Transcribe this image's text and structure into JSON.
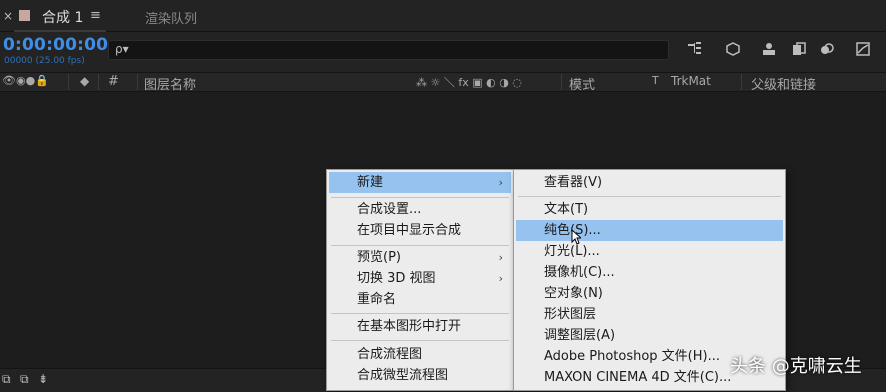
{
  "tabs": {
    "close": "×",
    "active_title": "合成 1",
    "menu": "≡",
    "inactive_title": "渲染队列"
  },
  "toolbar": {
    "timecode": "0:00:00:00",
    "frames": "00000 (25.00 fps)",
    "search_icon": "ρ▾"
  },
  "columns": {
    "layer_name": "图层名称",
    "hash": "#",
    "switches": "⁂ ☼ ＼ fx ▣ ◐ ◑ ◌",
    "mode": "模式",
    "t": "T",
    "trkmat": "TrkMat",
    "parent": "父级和链接"
  },
  "main_menu": {
    "items": [
      {
        "label": "新建",
        "submenu": true,
        "highlighted": true
      },
      {
        "label": "合成设置..."
      },
      {
        "label": "在项目中显示合成"
      },
      {
        "label": "预览(P)",
        "submenu": true
      },
      {
        "label": "切换 3D 视图",
        "submenu": true
      },
      {
        "label": "重命名"
      },
      {
        "label": "在基本图形中打开"
      },
      {
        "label": "合成流程图"
      },
      {
        "label": "合成微型流程图"
      }
    ]
  },
  "sub_menu": {
    "items": [
      {
        "label": "查看器(V)"
      },
      {
        "label": "文本(T)"
      },
      {
        "label": "纯色(S)...",
        "highlighted": true
      },
      {
        "label": "灯光(L)..."
      },
      {
        "label": "摄像机(C)..."
      },
      {
        "label": "空对象(N)"
      },
      {
        "label": "形状图层"
      },
      {
        "label": "调整图层(A)"
      },
      {
        "label": "Adobe Photoshop 文件(H)..."
      },
      {
        "label": "MAXON CINEMA 4D 文件(C)..."
      }
    ]
  },
  "watermark": "头条 @克啸云生",
  "colors": {
    "highlight": "#95c2ee",
    "timecode": "#3f8ee6",
    "background": "#1d1d1d"
  }
}
